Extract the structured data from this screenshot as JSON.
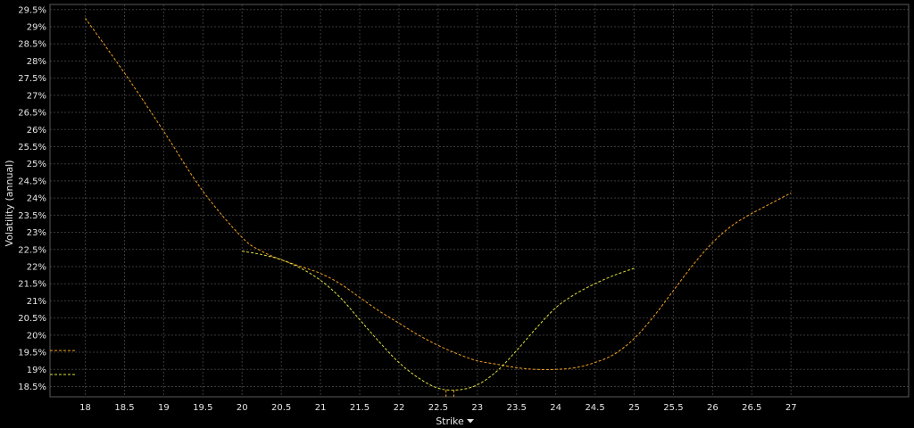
{
  "chart_data": {
    "type": "line",
    "title": "",
    "xlabel": "Strike",
    "ylabel": "Volatility (annual)",
    "xlim": [
      17.55,
      28.5
    ],
    "ylim": [
      18.2,
      29.65
    ],
    "grid": true,
    "x_ticks": [
      18,
      18.5,
      19,
      19.5,
      20,
      20.5,
      21,
      21.5,
      22,
      22.5,
      23,
      23.5,
      24,
      24.5,
      25,
      25.5,
      26,
      26.5,
      27
    ],
    "x_tick_labels": [
      "18",
      "18.5",
      "19",
      "19.5",
      "20",
      "20.5",
      "21",
      "21.5",
      "22",
      "22.5",
      "23",
      "23.5",
      "24",
      "24.5",
      "25",
      "25.5",
      "26",
      "26.5",
      "27"
    ],
    "y_ticks": [
      18.5,
      19,
      19.5,
      20,
      20.5,
      21,
      21.5,
      22,
      22.5,
      23,
      23.5,
      24,
      24.5,
      25,
      25.5,
      26,
      26.5,
      27,
      27.5,
      28,
      28.5,
      29,
      29.5
    ],
    "y_tick_labels": [
      "18.5%",
      "19%",
      "19.5%",
      "20%",
      "20.5%",
      "21%",
      "21.5%",
      "22%",
      "22.5%",
      "23%",
      "23.5%",
      "24%",
      "24.5%",
      "25%",
      "25.5%",
      "26%",
      "26.5%",
      "27%",
      "27.5%",
      "28%",
      "28.5%",
      "29%",
      "29.5%"
    ],
    "series": [
      {
        "color": "#f0a020",
        "x": [
          18,
          18.5,
          19,
          19.5,
          20,
          20.25,
          20.5,
          20.75,
          21,
          21.25,
          21.5,
          21.75,
          22,
          22.25,
          22.5,
          22.75,
          23,
          23.25,
          23.5,
          23.75,
          24,
          24.25,
          24.5,
          24.75,
          25,
          25.25,
          25.5,
          25.75,
          26,
          26.25,
          26.5,
          26.75,
          27
        ],
        "y": [
          29.25,
          27.65,
          25.95,
          24.2,
          22.85,
          22.45,
          22.2,
          22.0,
          21.8,
          21.5,
          21.1,
          20.7,
          20.35,
          20.0,
          19.7,
          19.45,
          19.25,
          19.15,
          19.05,
          19.0,
          19.0,
          19.05,
          19.2,
          19.45,
          19.9,
          20.55,
          21.3,
          22.05,
          22.7,
          23.2,
          23.55,
          23.85,
          24.15
        ]
      },
      {
        "color": "#e0e040",
        "x": [
          20,
          20.25,
          20.5,
          20.75,
          21,
          21.25,
          21.5,
          21.75,
          22,
          22.25,
          22.5,
          22.75,
          23,
          23.25,
          23.5,
          23.75,
          24,
          24.25,
          24.5,
          24.75,
          25
        ],
        "y": [
          22.45,
          22.35,
          22.2,
          21.95,
          21.6,
          21.1,
          20.45,
          19.8,
          19.2,
          18.75,
          18.45,
          18.4,
          18.55,
          18.95,
          19.55,
          20.2,
          20.8,
          21.2,
          21.5,
          21.75,
          21.95
        ]
      }
    ],
    "left_markers": [
      {
        "color": "#f0a020",
        "y": 19.55
      },
      {
        "color": "#e0e040",
        "y": 18.85
      }
    ],
    "min_markers": [
      {
        "color": "#f0a020",
        "x": 22.6
      },
      {
        "color": "#f0a020",
        "x": 22.7
      }
    ],
    "dropdown_icon": "caret-down-icon",
    "colors": {
      "background": "#000000",
      "grid": "#3a3a3a",
      "text": "#e6e6e6"
    }
  }
}
